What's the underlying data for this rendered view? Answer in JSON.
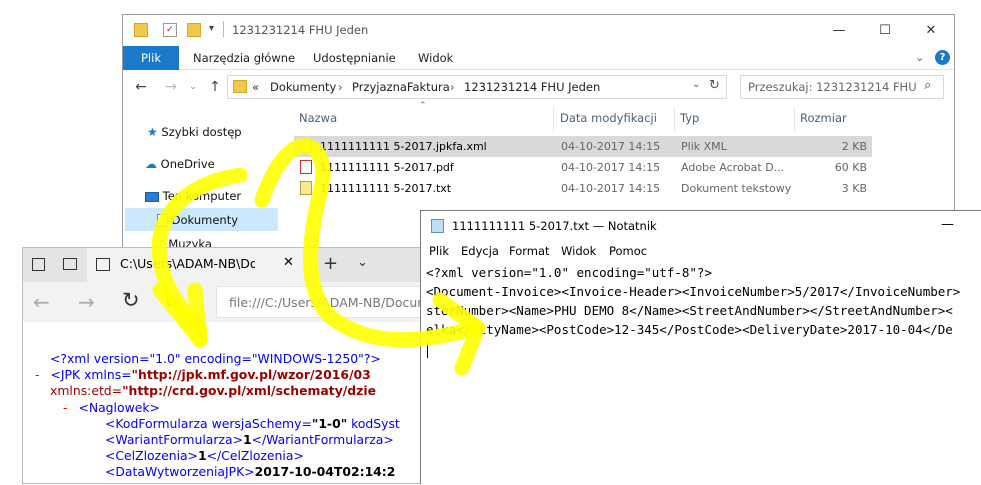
{
  "explorer": {
    "title": "1231231214 FHU Jeden",
    "ribbon_tabs": [
      "Plik",
      "Narzędzia główne",
      "Udostępnianie",
      "Widok"
    ],
    "breadcrumb": [
      "«",
      "Dokumenty",
      "›",
      "PrzyjaznaFaktura",
      "›",
      "1231231214 FHU Jeden"
    ],
    "search_placeholder": "Przeszukaj: 1231231214 FHU J...",
    "columns": [
      "Nazwa",
      "Data modyfikacji",
      "Typ",
      "Rozmiar"
    ],
    "nav_items": [
      "Szybki dostęp",
      "OneDrive",
      "Ten komputer",
      "Dokumenty",
      "Muzyka"
    ],
    "files": [
      {
        "name": "1111111111 5-2017.jpkfa.xml",
        "date": "04-10-2017 14:15",
        "type": "Plik XML",
        "size": "2 KB"
      },
      {
        "name": "1111111111 5-2017.pdf",
        "date": "04-10-2017 14:15",
        "type": "Adobe Acrobat D...",
        "size": "60 KB"
      },
      {
        "name": "1111111111 5-2017.txt",
        "date": "04-10-2017 14:15",
        "type": "Dokument tekstowy",
        "size": "3 KB"
      }
    ]
  },
  "edge": {
    "tab_title": "C:\\Users\\ADAM-NB\\Do",
    "address": "file:///C:/Users/ADAM-NB/Docum",
    "xml_lines": {
      "l1_pi": "<?xml version=\"1.0\" encoding=\"WINDOWS-1250\"?>",
      "l2_minus": "-",
      "l2_tag": "<JPK xmlns=",
      "l2_val": "\"http://jpk.mf.gov.pl/wzor/2016/03",
      "l3_attr": "xmlns:etd=",
      "l3_val": "\"http://crd.gov.pl/xml/schematy/dzie",
      "l4_minus": "-",
      "l4_tag": "<Naglowek>",
      "l5_tag": "<KodFormularza wersjaSchemy=",
      "l5_val": "\"1-0\"",
      "l5_rest": " kodSyst",
      "l6_open": "<WariantFormularza>",
      "l6_val": "1",
      "l6_close": "</WariantFormularza>",
      "l7_open": "<CelZlozenia>",
      "l7_val": "1",
      "l7_close": "</CelZlozenia>",
      "l8_open": "<DataWytworzeniaJPK>",
      "l8_val": "2017-10-04T02:14:2"
    }
  },
  "notepad": {
    "title": "1111111111 5-2017.txt — Notatnik",
    "menu": [
      "Plik",
      "Edycja",
      "Format",
      "Widok",
      "Pomoc"
    ],
    "lines": [
      "<?xml version=\"1.0\" encoding=\"utf-8\"?>",
      "<Document-Invoice><Invoice-Header><InvoiceNumber>5/2017</InvoiceNumber>",
      "sterNumber><Name>PHU DEMO 8</Name><StreetAndNumber></StreetAndNumber><",
      "elka</CityName><PostCode>12-345</PostCode><DeliveryDate>2017-10-04</De"
    ]
  },
  "colors": {
    "highlight_yellow": "#ffff00",
    "ribbon_file_blue": "#1979ca",
    "xml_blue": "#0000ff",
    "xml_red": "#990000"
  }
}
